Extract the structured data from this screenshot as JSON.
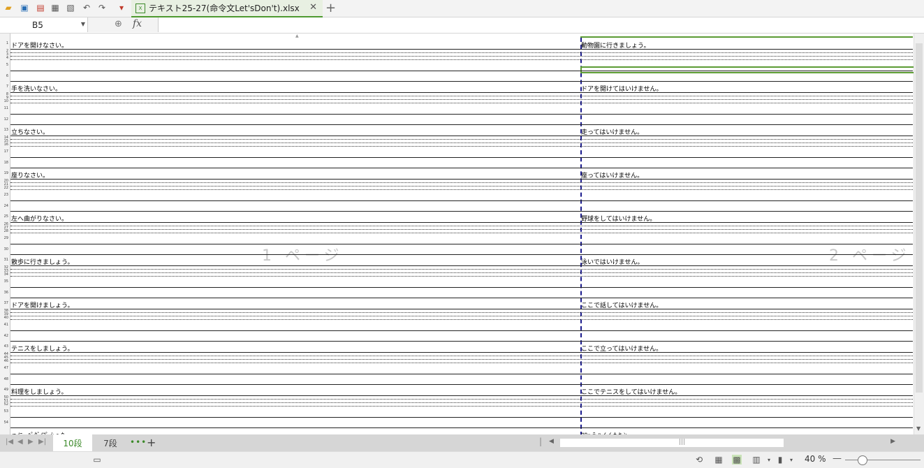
{
  "toolbar": {
    "icons": [
      "open-folder-icon",
      "save-icon",
      "export-pdf-icon",
      "print-icon",
      "print-preview-icon",
      "undo-icon",
      "redo-icon",
      "quick-access-dropdown-icon"
    ]
  },
  "document_tab": {
    "title": "テキスト25-27(命令文Let'sDon't).xlsx"
  },
  "formula_bar": {
    "cell_reference": "B5",
    "fx_label": "fx"
  },
  "grid": {
    "selected_cell": "B5",
    "row_numbers": [
      "1",
      "2",
      "3",
      "4",
      "5",
      "6",
      "7",
      "8",
      "9",
      "10",
      "11",
      "12",
      "13",
      "14",
      "15",
      "16",
      "17",
      "18",
      "19",
      "20",
      "21",
      "22",
      "23",
      "24",
      "25",
      "26",
      "27",
      "28",
      "29",
      "30",
      "31",
      "32",
      "33",
      "34",
      "35",
      "36",
      "37",
      "38",
      "39",
      "40",
      "41",
      "42",
      "43",
      "44",
      "45",
      "46",
      "47",
      "48",
      "49",
      "50",
      "51",
      "52",
      "53",
      "54"
    ],
    "column_a": [
      "ドアを開けなさい。",
      "手を洗いなさい。",
      "立ちなさい。",
      "座りなさい。",
      "左へ曲がりなさい。",
      "散歩に行きましょう。",
      "ドアを開けましょう。",
      "テニスをしましょう。",
      "料理をしましょう。",
      "ｎ/ﾆ_ ﾊﾟﾀﾞ/ﾌﾟ ｼ ｮ ｳ"
    ],
    "column_b": [
      "動物園に行きましょう。",
      "ドアを開けてはいけません。",
      "走ってはいけません。",
      "座ってはいけません。",
      "野球をしてはいけません。",
      "泳いではいけません。",
      "ここで話してはいけません。",
      "ここで立ってはいけません。",
      "ここでテニスをしてはいけません。",
      "ﾛﾛｯ  ﾃ-ﾊ ｲ ｲ ﾅ ｾ ﾝ"
    ],
    "page_labels": [
      "1 ページ",
      "2 ページ"
    ]
  },
  "sheet_tabs": {
    "tabs": [
      {
        "label": "10段",
        "active": true
      },
      {
        "label": "7段",
        "active": false
      }
    ],
    "more_label": "•••",
    "add_label": "+"
  },
  "status_bar": {
    "zoom_percent": "40 %",
    "zoom_level": 0.4
  }
}
